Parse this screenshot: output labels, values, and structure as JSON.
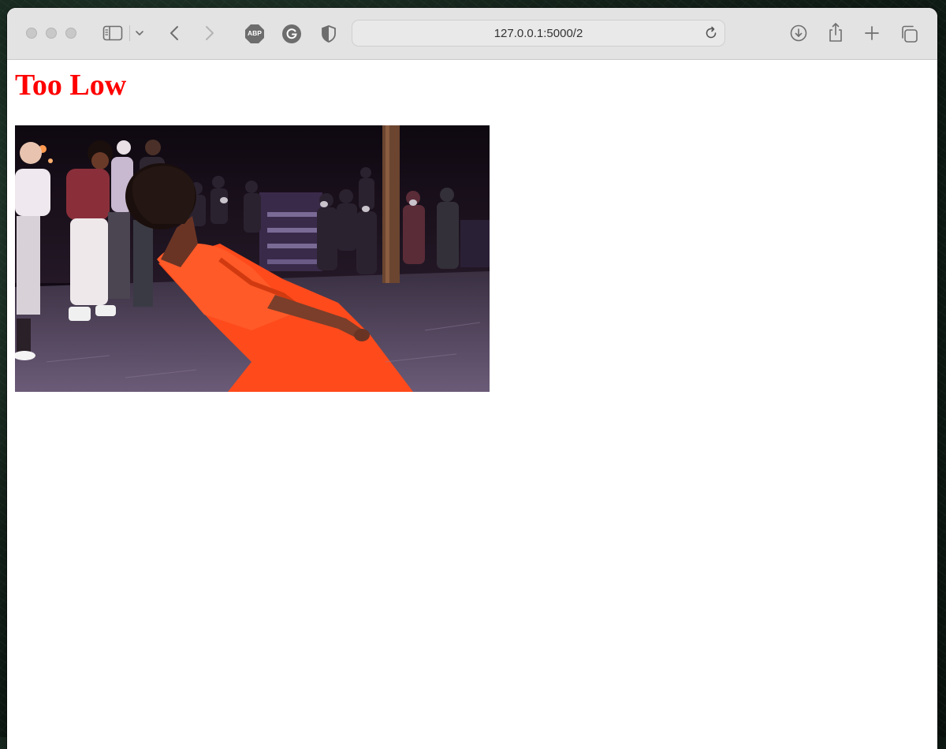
{
  "browser": {
    "url": "127.0.0.1:5000/2",
    "icons": {
      "traffic_lights": [
        "close-icon",
        "minimize-icon",
        "zoom-icon"
      ],
      "sidebar": "sidebar-icon",
      "sidebar_menu": "chevron-down-icon",
      "back": "chevron-left-icon",
      "forward": "chevron-right-icon",
      "adblock": "abp-icon",
      "grammarly": "grammarly-icon",
      "privacy": "shield-icon",
      "reload": "reload-icon",
      "downloads": "download-icon",
      "share": "share-icon",
      "new_tab": "plus-icon",
      "tabs": "tab-overview-icon"
    },
    "adblock_label": "ABP"
  },
  "page": {
    "heading": "Too Low",
    "heading_color": "#ff0000",
    "image": {
      "subject": "dancer in orange leaning back on a stage with onlookers"
    }
  }
}
